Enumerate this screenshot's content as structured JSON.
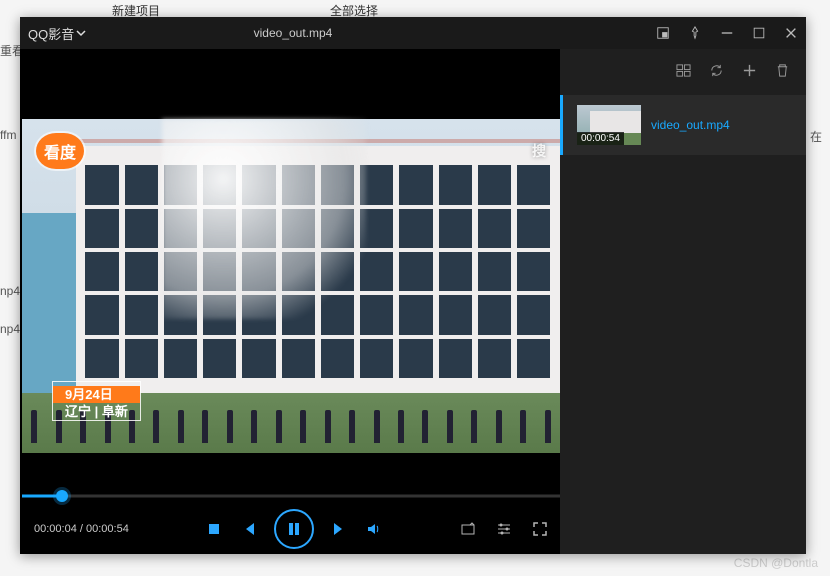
{
  "bg": {
    "top1": "新建项目",
    "top2": "全部选择",
    "left1": "重看",
    "left2": "ffm",
    "ext1": "np4",
    "ext2": "np4",
    "right_cut": "在"
  },
  "watermark": "CSDN @Dontla",
  "app": {
    "brand": "QQ影音",
    "title": "video_out.mp4"
  },
  "video": {
    "logo": "看度",
    "watermark_right": "搜",
    "caption_date": "9月24日",
    "caption_location": "辽宁 | 阜新"
  },
  "playback": {
    "current": "00:00:04",
    "total": "00:00:54",
    "progress_pct": 7.4
  },
  "playlist": {
    "items": [
      {
        "name": "video_out.mp4",
        "duration": "00:00:54"
      }
    ]
  }
}
